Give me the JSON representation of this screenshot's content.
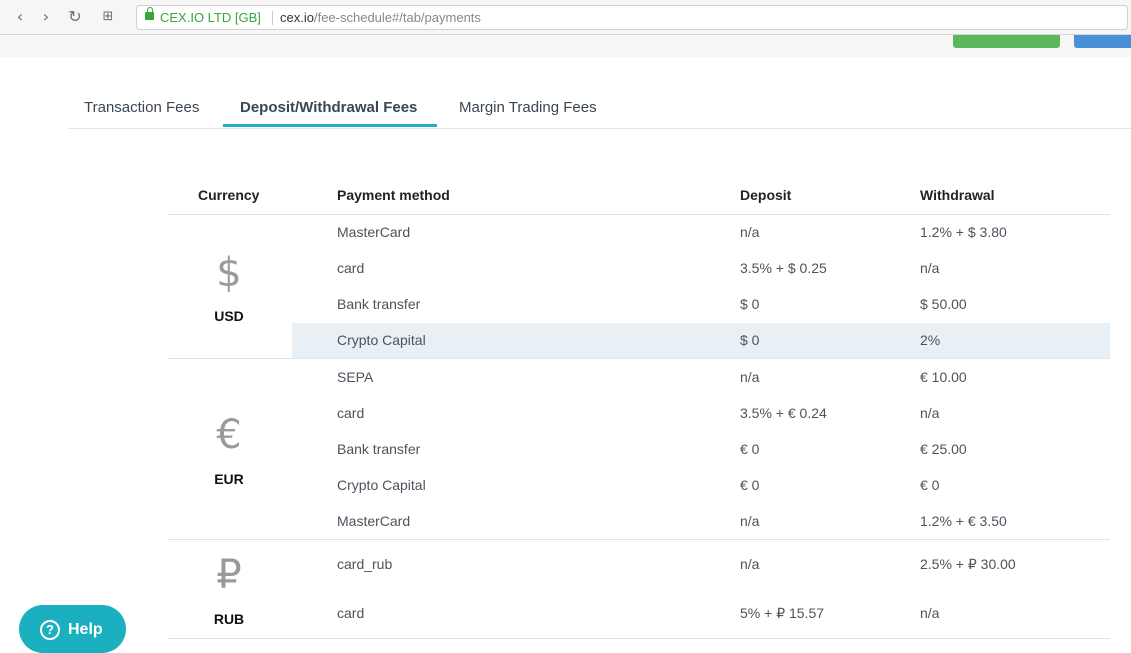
{
  "browser": {
    "site_identity": "CEX.IO LTD [GB]",
    "url_host": "cex.io",
    "url_path": "/fee-schedule#/tab/payments"
  },
  "tabs": [
    {
      "label": "Transaction Fees"
    },
    {
      "label": "Deposit/Withdrawal Fees"
    },
    {
      "label": "Margin Trading Fees"
    }
  ],
  "table": {
    "headers": {
      "currency": "Currency",
      "method": "Payment method",
      "deposit": "Deposit",
      "withdrawal": "Withdrawal"
    },
    "groups": [
      {
        "symbol": "$",
        "code": "USD",
        "rows": [
          {
            "method": "MasterCard",
            "deposit": "n/a",
            "withdrawal": "1.2% + $ 3.80"
          },
          {
            "method": "card",
            "deposit": "3.5% + $ 0.25",
            "withdrawal": "n/a"
          },
          {
            "method": "Bank transfer",
            "deposit": "$ 0",
            "withdrawal": "$ 50.00"
          },
          {
            "method": "Crypto Capital",
            "deposit": "$ 0",
            "withdrawal": "2%"
          }
        ]
      },
      {
        "symbol": "€",
        "code": "EUR",
        "rows": [
          {
            "method": "SEPA",
            "deposit": "n/a",
            "withdrawal": "€ 10.00"
          },
          {
            "method": "card",
            "deposit": "3.5% + € 0.24",
            "withdrawal": "n/a"
          },
          {
            "method": "Bank transfer",
            "deposit": "€ 0",
            "withdrawal": "€ 25.00"
          },
          {
            "method": "Crypto Capital",
            "deposit": "€ 0",
            "withdrawal": "€ 0"
          },
          {
            "method": "MasterCard",
            "deposit": "n/a",
            "withdrawal": "1.2% + € 3.50"
          }
        ]
      },
      {
        "symbol": "₽",
        "code": "RUB",
        "rows": [
          {
            "method": "card_rub",
            "deposit": "n/a",
            "withdrawal": "2.5% + ₽ 30.00"
          },
          {
            "method": "card",
            "deposit": "5% + ₽ 15.57",
            "withdrawal": "n/a"
          }
        ]
      }
    ]
  },
  "help": {
    "label": "Help"
  }
}
